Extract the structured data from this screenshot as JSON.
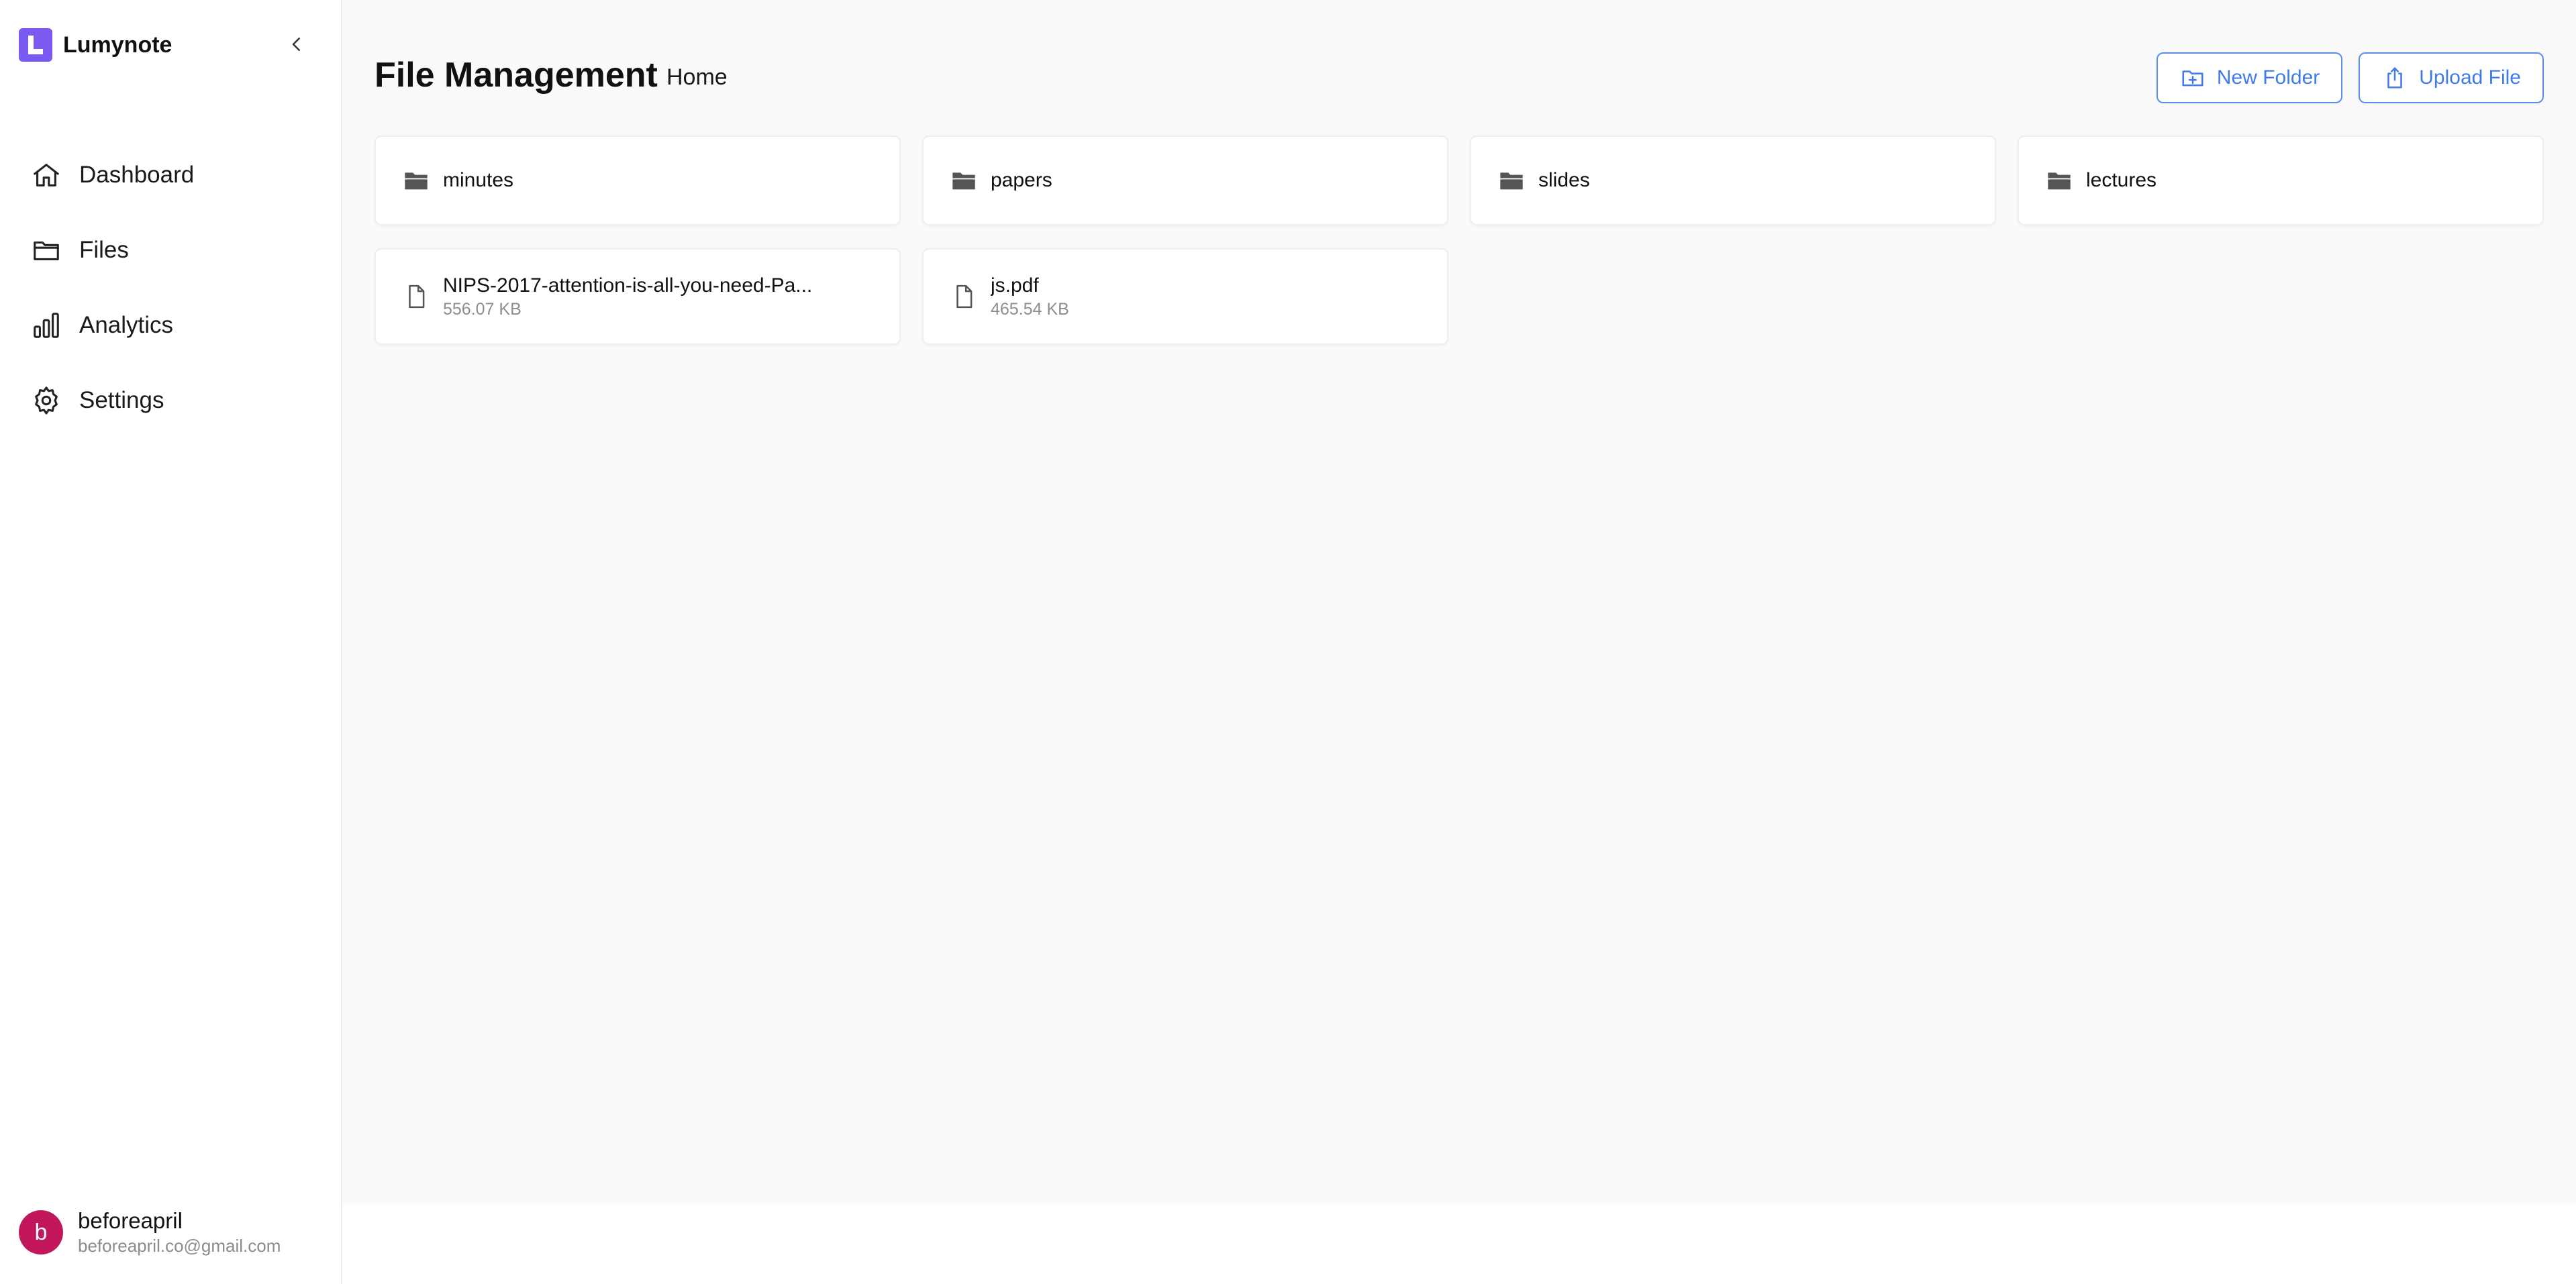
{
  "brand": {
    "name": "Lumynote",
    "logo_color": "#7a5af0"
  },
  "sidebar": {
    "items": [
      {
        "label": "Dashboard",
        "icon": "home-icon"
      },
      {
        "label": "Files",
        "icon": "folder-icon"
      },
      {
        "label": "Analytics",
        "icon": "bar-chart-icon"
      },
      {
        "label": "Settings",
        "icon": "gear-icon"
      }
    ],
    "user": {
      "initial": "b",
      "name": "beforeapril",
      "email": "beforeapril.co@gmail.com",
      "avatar_color": "#c2185b"
    }
  },
  "header": {
    "title": "File Management",
    "breadcrumb": "Home",
    "new_folder_label": "New Folder",
    "upload_file_label": "Upload File",
    "accent_color": "#3f7be8"
  },
  "folders": [
    {
      "name": "minutes"
    },
    {
      "name": "papers"
    },
    {
      "name": "slides"
    },
    {
      "name": "lectures"
    }
  ],
  "files": [
    {
      "name": "NIPS-2017-attention-is-all-you-need-Pa...",
      "size": "556.07 KB"
    },
    {
      "name": "js.pdf",
      "size": "465.54 KB"
    }
  ]
}
